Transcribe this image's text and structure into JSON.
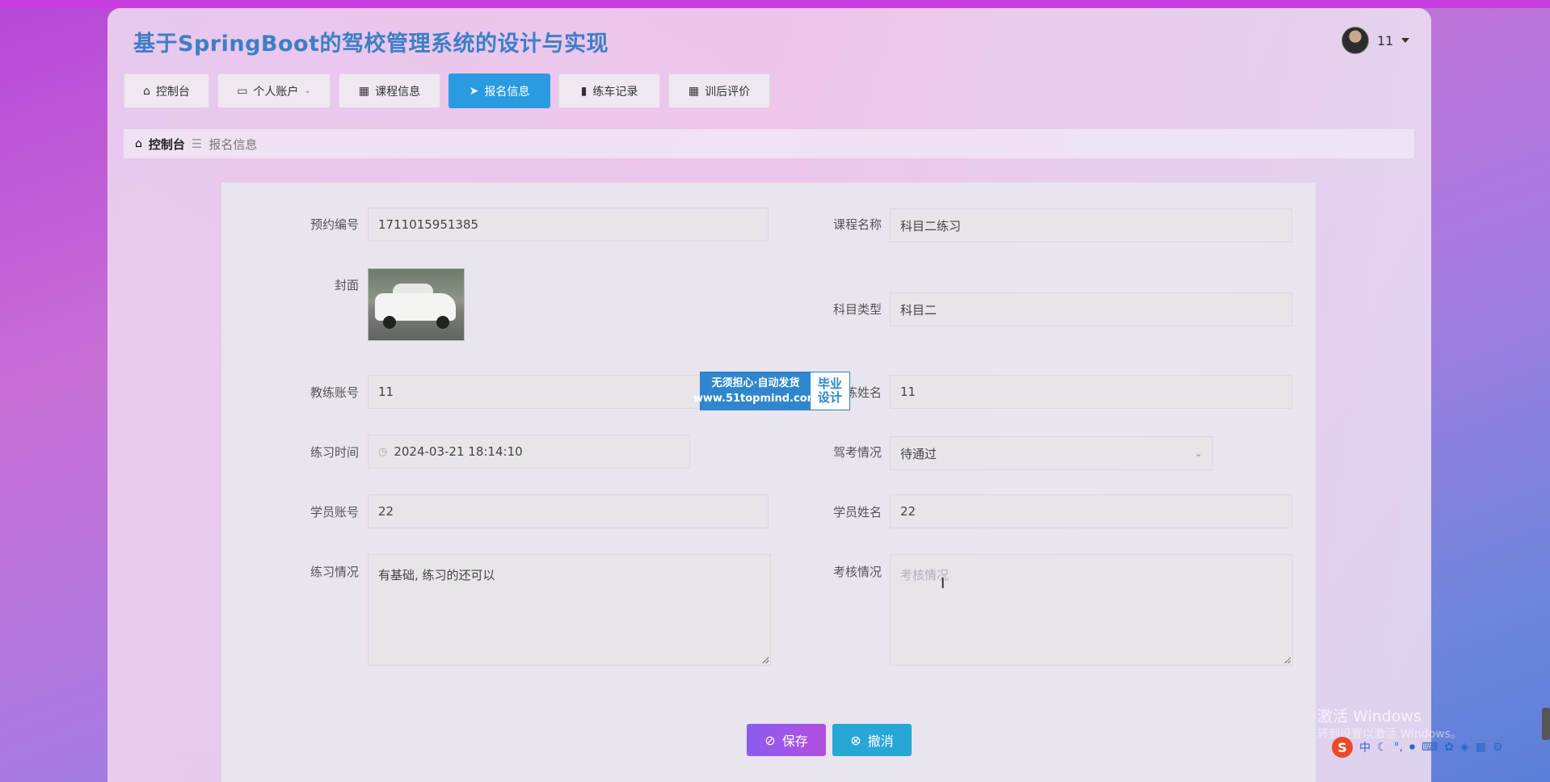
{
  "app_title": "基于SpringBoot的驾校管理系统的设计与实现",
  "user": {
    "name": "11"
  },
  "nav": [
    {
      "label": "控制台",
      "icon": "home-icon"
    },
    {
      "label": "个人账户",
      "icon": "wallet-icon"
    },
    {
      "label": "课程信息",
      "icon": "grid-icon"
    },
    {
      "label": "报名信息",
      "icon": "send-icon",
      "active": true
    },
    {
      "label": "练车记录",
      "icon": "bar-chart-icon"
    },
    {
      "label": "训后评价",
      "icon": "grid-icon"
    }
  ],
  "breadcrumb": {
    "home": "控制台",
    "current": "报名信息"
  },
  "form": {
    "booking_no": {
      "label": "预约编号",
      "value": "1711015951385"
    },
    "course_name": {
      "label": "课程名称",
      "value": "科目二练习"
    },
    "cover": {
      "label": "封面"
    },
    "subject_type": {
      "label": "科目类型",
      "value": "科目二"
    },
    "coach_account": {
      "label": "教练账号",
      "value": "11"
    },
    "coach_name": {
      "label": "教练姓名",
      "value": "11"
    },
    "practice_time": {
      "label": "练习时间",
      "value": "2024-03-21 18:14:10"
    },
    "exam_status": {
      "label": "驾考情况",
      "value": "待通过"
    },
    "student_account": {
      "label": "学员账号",
      "value": "22"
    },
    "student_name": {
      "label": "学员姓名",
      "value": "22"
    },
    "practice_status": {
      "label": "练习情况",
      "value": "有基础, 练习的还可以"
    },
    "assessment": {
      "label": "考核情况",
      "placeholder": "考核情况"
    }
  },
  "buttons": {
    "save": "保存",
    "cancel": "撤消"
  },
  "watermark": {
    "line1": "无须担心·自动发货",
    "line2": "www.51topmind.com",
    "badge1": "毕业",
    "badge2": "设计"
  },
  "os": {
    "activate_line1": "激活 Windows",
    "activate_line2": "转到设置以激活 Windows。",
    "ime": "中"
  },
  "colors": {
    "accent": "#2a9be0",
    "title": "#3c7fc6",
    "save": "#8b5cf0",
    "cancel": "#27a7d6"
  }
}
